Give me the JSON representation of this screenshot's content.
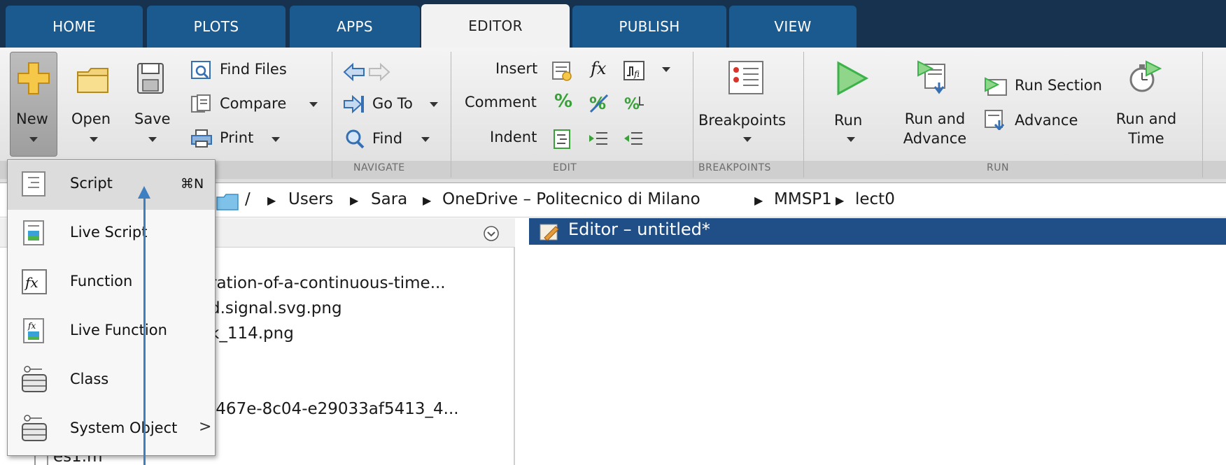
{
  "tabs": [
    {
      "label": "HOME"
    },
    {
      "label": "PLOTS"
    },
    {
      "label": "APPS"
    },
    {
      "label": "EDITOR"
    },
    {
      "label": "PUBLISH"
    },
    {
      "label": "VIEW"
    }
  ],
  "active_tab": "EDITOR",
  "ribbon": {
    "file": {
      "new": "New",
      "open": "Open",
      "save": "Save",
      "find_files": "Find Files",
      "compare": "Compare",
      "print": "Print"
    },
    "navigate": {
      "go_to": "Go To",
      "find": "Find",
      "section": "NAVIGATE"
    },
    "edit": {
      "insert": "Insert",
      "comment": "Comment",
      "indent": "Indent",
      "fx": "fx",
      "section": "EDIT"
    },
    "breakpoints": {
      "label": "Breakpoints",
      "section": "BREAKPOINTS"
    },
    "run": {
      "run": "Run",
      "run_and_advance_1": "Run and",
      "run_and_advance_2": "Advance",
      "run_section": "Run Section",
      "advance": "Advance",
      "run_and_time_1": "Run and",
      "run_and_time_2": "Time",
      "section": "RUN"
    }
  },
  "address": {
    "separator": "/",
    "crumbs": [
      "Users",
      "Sara",
      "OneDrive – Politecnico di Milano",
      "MMSP1",
      "lect0"
    ]
  },
  "file_panel": {
    "files": [
      "ration-of-a-continuous-time...",
      "d.signal.svg.png",
      "k_114.png",
      "-467e-8c04-e29033af5413_4...",
      "es1.m"
    ]
  },
  "editor": {
    "title": "Editor – untitled*"
  },
  "new_menu": {
    "items": [
      {
        "label": "Script",
        "shortcut": "⌘N",
        "icon": "script-icon"
      },
      {
        "label": "Live Script",
        "icon": "live-script-icon"
      },
      {
        "label": "Function",
        "icon": "function-icon"
      },
      {
        "label": "Live Function",
        "icon": "live-function-icon"
      },
      {
        "label": "Class",
        "icon": "class-icon"
      },
      {
        "label": "System Object",
        "icon": "system-object-icon",
        "submenu_arrow": ">"
      }
    ]
  },
  "colors": {
    "tab_bar": "#17324f",
    "tab": "#1b5a8e",
    "editor_header": "#1f4f86",
    "pointer": "#3d7fc1",
    "run_green": "#3cb24a"
  }
}
